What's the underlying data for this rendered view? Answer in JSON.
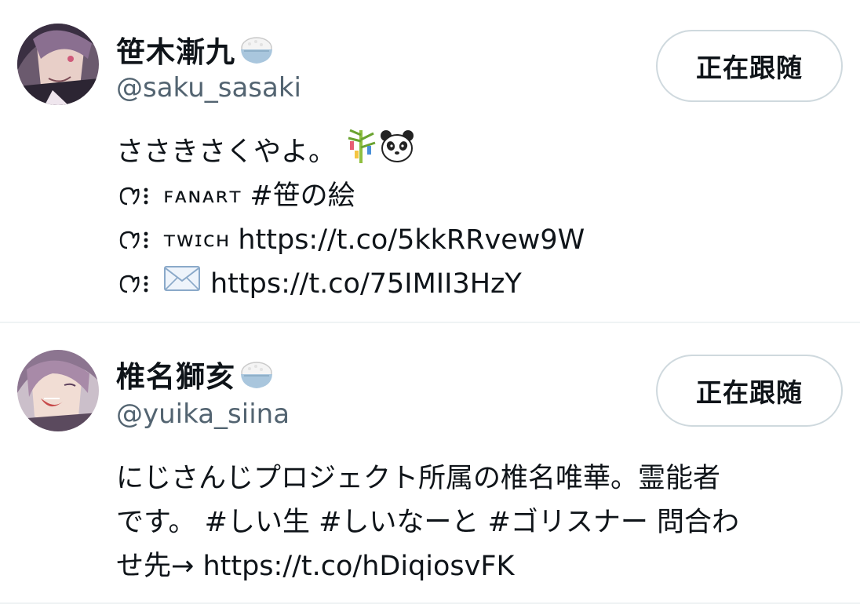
{
  "users": [
    {
      "name": "笹木漸九",
      "handle": "@saku_sasaki",
      "follow_label": "正在跟随",
      "bio": {
        "line1": "ささきさくやよ。",
        "line2_tag": "ꜰᴀɴᴀʀᴛ",
        "line2_text": "#笹の絵",
        "line3_tag": "ᴛᴡɪᴄʜ",
        "line3_text": "https://t.co/5kkRRvew9W",
        "line4_text": "https://t.co/75IMII3HzY"
      }
    },
    {
      "name": "椎名獅亥",
      "handle": "@yuika_siina",
      "follow_label": "正在跟随",
      "bio": {
        "line1": "にじさんじプロジェクト所属の椎名唯華。霊能者",
        "line2": "です。 #しい生 #しいなーと #ゴリスナー 問合わ",
        "line3": "せ先→ https://t.co/hDiqiosvFK"
      }
    }
  ],
  "colors": {
    "text": "#0f1419",
    "secondary": "#536471",
    "border": "#cfd9de",
    "divider": "#eff3f4"
  },
  "icons": [
    "rice-bowl-icon",
    "tanabata-tree-icon",
    "panda-icon",
    "bullet-icon",
    "envelope-icon"
  ]
}
